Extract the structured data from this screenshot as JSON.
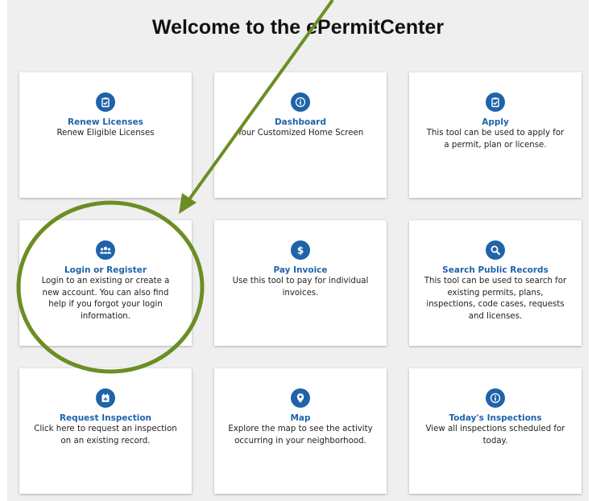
{
  "page": {
    "title": "Welcome to the ePermitCenter"
  },
  "cards": [
    {
      "title": "Renew Licenses",
      "description": "Renew Eligible Licenses",
      "icon": "clipboard-check-icon"
    },
    {
      "title": "Dashboard",
      "description": "Your Customized Home Screen",
      "icon": "info-icon"
    },
    {
      "title": "Apply",
      "description": "This tool can be used to apply for a permit, plan or license.",
      "icon": "clipboard-check-icon"
    },
    {
      "title": "Login or Register",
      "description": "Login to an existing or create a new account. You can also find help if you forgot your login information.",
      "icon": "users-icon"
    },
    {
      "title": "Pay Invoice",
      "description": "Use this tool to pay for individual invoices.",
      "icon": "dollar-icon"
    },
    {
      "title": "Search Public Records",
      "description": "This tool can be used to search for existing permits, plans, inspections, code cases, requests and licenses.",
      "icon": "search-icon"
    },
    {
      "title": "Request Inspection",
      "description": "Click here to request an inspection on an existing record.",
      "icon": "calendar-plus-icon"
    },
    {
      "title": "Map",
      "description": "Explore the map to see the activity occurring in your neighborhood.",
      "icon": "map-pin-icon"
    },
    {
      "title": "Today's Inspections",
      "description": "View all inspections scheduled for today.",
      "icon": "info-icon"
    }
  ],
  "colors": {
    "accent": "#1f63a9",
    "annotation": "#6b8e23",
    "background": "#efefef"
  }
}
